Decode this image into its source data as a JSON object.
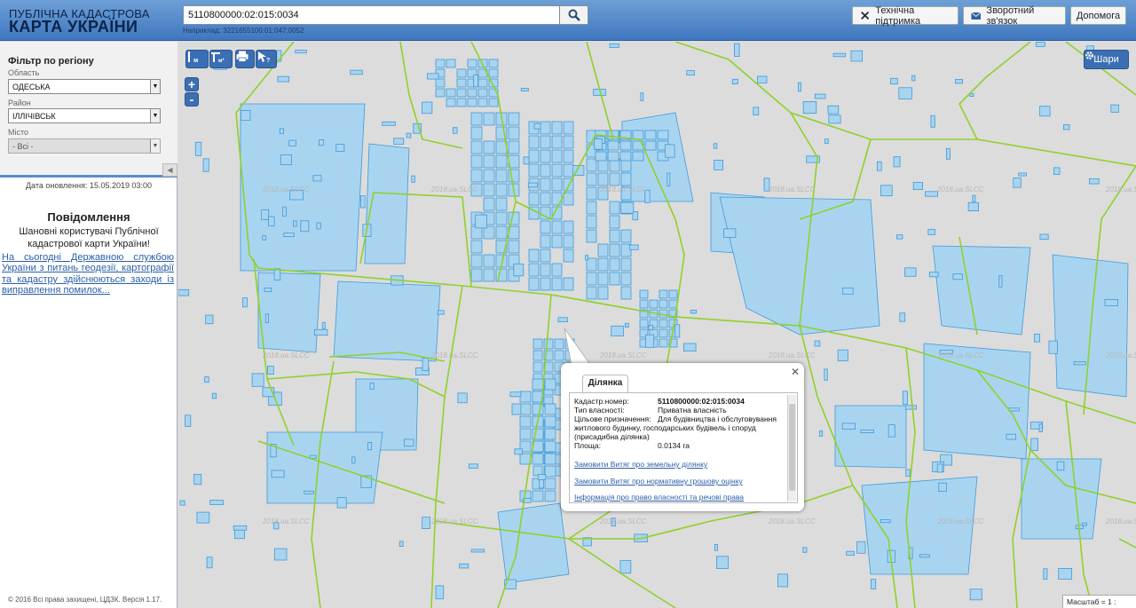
{
  "header": {
    "logo_line1": "ПУБЛІЧНА КАДАСТРОВА",
    "logo_line2": "КАРТА УКРАЇНИ",
    "search_value": "5110800000:02:015:0034",
    "search_hint": "Наприклад: 3221655100:01:047:0052",
    "support_label": "Технічна підтримка",
    "feedback_label": "Зворотний зв'язок",
    "help_label": "Допомога"
  },
  "filter": {
    "title": "Фільтр по регіону",
    "oblast_label": "Область",
    "oblast_value": "ОДЕСЬКА",
    "raion_label": "Район",
    "raion_value": "ІЛЛІЧІВСЬК",
    "misto_label": "Місто",
    "misto_value": "- Всі -"
  },
  "sidebar": {
    "update_date": "Дата оновлення: 15.05.2019 03:00",
    "notice_title": "Повідомлення",
    "notice_body": "Шановні користувачі Публічної кадастрової карти України!",
    "notice_link": "На сьогодні Державною службою України з питань геодезії, картографії та кадастру здійснюються заходи із виправлення помилок...",
    "copyright": "© 2016 Всі права захищені, ЦДЗК. Версія 1.17."
  },
  "map": {
    "layers_label": "Шари",
    "zoom_in": "+",
    "zoom_out": "-",
    "scale_text": "Масштаб = 1 : 8531",
    "watermark": "2018.ua.SLCC"
  },
  "popup": {
    "tab": "Ділянка",
    "cad_label": "Кадастр.номер:",
    "cad_value": "5110800000:02:015:0034",
    "own_label": "Тип власності:",
    "own_value": "Приватна власність",
    "purpose_label": "Цільове призначення:",
    "purpose_value_1": "Для будівництва і обслуговування",
    "purpose_value_2": "житлового будинку, господарських будівель і споруд",
    "purpose_value_3": "(присадибна ділянка)",
    "area_label": "Площа:",
    "area_value": "0.0134 га",
    "link1": "Замовити Витяг про земельну ділянку",
    "link2": "Замовити Витяг про нормативну грошову оцінку",
    "link3": "Інформація про право власності та речові права"
  },
  "colors": {
    "header": "#4a80c6",
    "parcel_fill": "#a9d4f0",
    "parcel_stroke": "#3f9ad8",
    "boundary": "#8fd12a",
    "link": "#2a5fa8"
  }
}
